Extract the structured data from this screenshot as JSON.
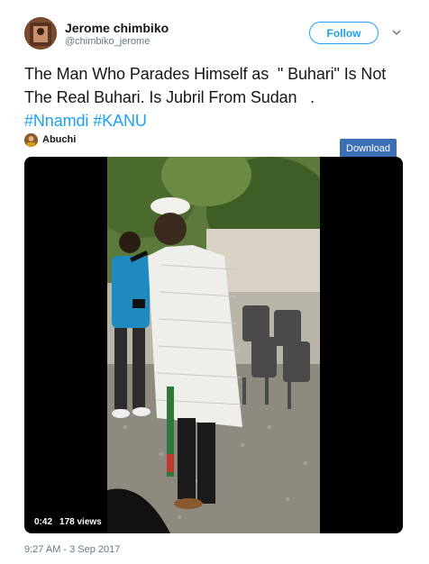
{
  "author": {
    "name": "Jerome chimbiko",
    "handle": "@chimbiko_jerome"
  },
  "follow_label": "Follow",
  "tweet": {
    "text": "The Man Who Parades Himself as  \" Buhari\" Is Not The Real Buhari. Is Jubril From Sudan   .",
    "hashtags": [
      "#Nnamdi",
      "#KANU"
    ]
  },
  "media_credit": "Abuchi",
  "download_label": "Download",
  "video": {
    "duration": "0:42",
    "views": "178 views"
  },
  "timestamp": "9:27 AM - 3 Sep 2017",
  "colors": {
    "accent": "#1da1f2",
    "download": "#3b6fb6",
    "muted": "#657786"
  }
}
